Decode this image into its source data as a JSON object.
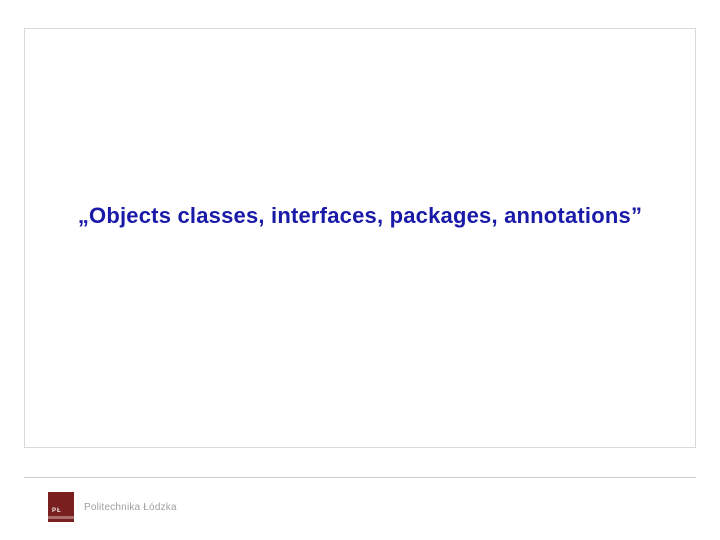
{
  "slide": {
    "title": "„Objects classes, interfaces, packages, annotations”"
  },
  "footer": {
    "university": "Politechnika Łódzka",
    "logo_text": "PŁ"
  }
}
